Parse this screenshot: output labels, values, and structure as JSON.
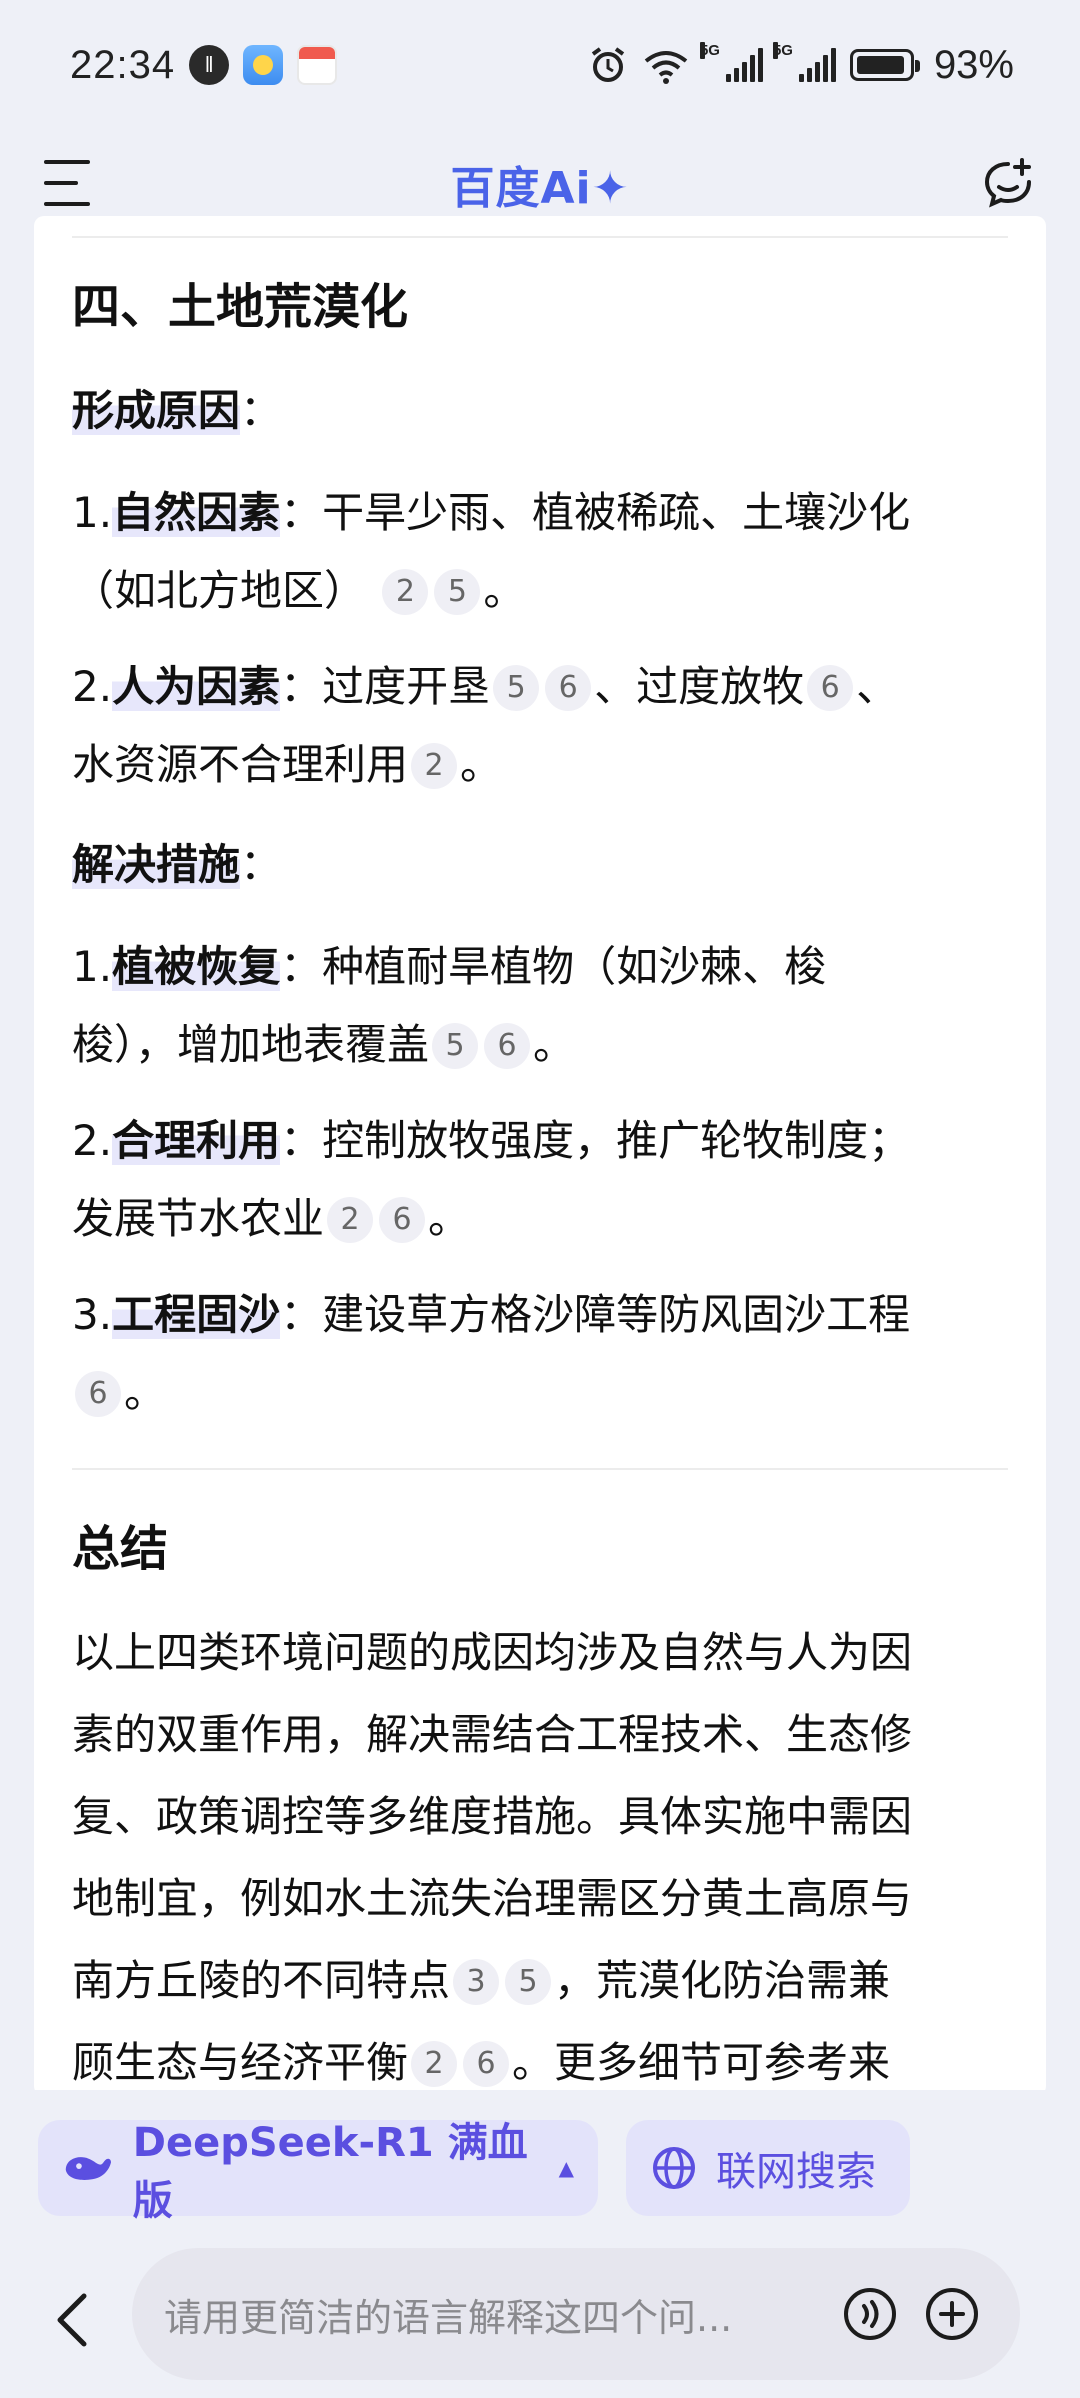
{
  "status_bar": {
    "time": "22:34",
    "battery": "93%",
    "icons": [
      "app-circle-icon",
      "weather-icon",
      "calendar-icon",
      "alarm-icon",
      "wifi-icon",
      "signal-5g-icon",
      "signal-5g-icon"
    ],
    "network_tags": [
      "6",
      "5G",
      "5G"
    ]
  },
  "header": {
    "title": "百度Ai✦",
    "brand_color": "#4a63e8"
  },
  "section4": {
    "title": "四、土地荒漠化",
    "cause_heading": "形成原因",
    "causes": [
      {
        "num": "1.",
        "label": "自然因素",
        "text": "：干旱少雨、植被稀疏、土壤沙化",
        "text2": "（如北方地区）",
        "cites": [
          "2",
          "5"
        ],
        "end": "。"
      },
      {
        "num": "2.",
        "label": "人为因素",
        "text": "：过度开垦",
        "cites_a": [
          "5",
          "6"
        ],
        "text_b": "、过度放牧",
        "cites_b": [
          "6"
        ],
        "text_c": "、",
        "text2": "水资源不合理利用",
        "cites_c": [
          "2"
        ],
        "end": "。"
      }
    ],
    "measure_heading": "解决措施",
    "measures": [
      {
        "num": "1.",
        "label": "植被恢复",
        "text": "：种植耐旱植物（如沙棘、梭",
        "text2": "梭），增加地表覆盖",
        "cites": [
          "5",
          "6"
        ],
        "end": "。"
      },
      {
        "num": "2.",
        "label": "合理利用",
        "text": "：控制放牧强度，推广轮牧制度；",
        "text2": "发展节水农业",
        "cites": [
          "2",
          "6"
        ],
        "end": "。"
      },
      {
        "num": "3.",
        "label": "工程固沙",
        "text": "：建设草方格沙障等防风固沙工程",
        "cites": [
          "6"
        ],
        "end": "。"
      }
    ]
  },
  "summary": {
    "title": "总结",
    "lines": [
      "以上四类环境问题的成因均涉及自然与人为因",
      "素的双重作用，解决需结合工程技术、生态修",
      "复、政策调控等多维度措施。具体实施中需因",
      "地制宜，例如水土流失治理需区分黄土高原与"
    ],
    "line5_a": "南方丘陵的不同特点",
    "line5_cites": [
      "3",
      "5"
    ],
    "line5_b": "，荒漠化防治需兼",
    "line6_a": "顾生态与经济平衡",
    "line6_cites": [
      "2",
      "6"
    ],
    "line6_b": "。更多细节可参考来"
  },
  "bottom": {
    "model_label": "DeepSeek-R1 满血版",
    "search_label": "联网搜索",
    "input_placeholder": "请用更简洁的语言解释这四个问...",
    "accent_color": "#5b4fe0"
  }
}
